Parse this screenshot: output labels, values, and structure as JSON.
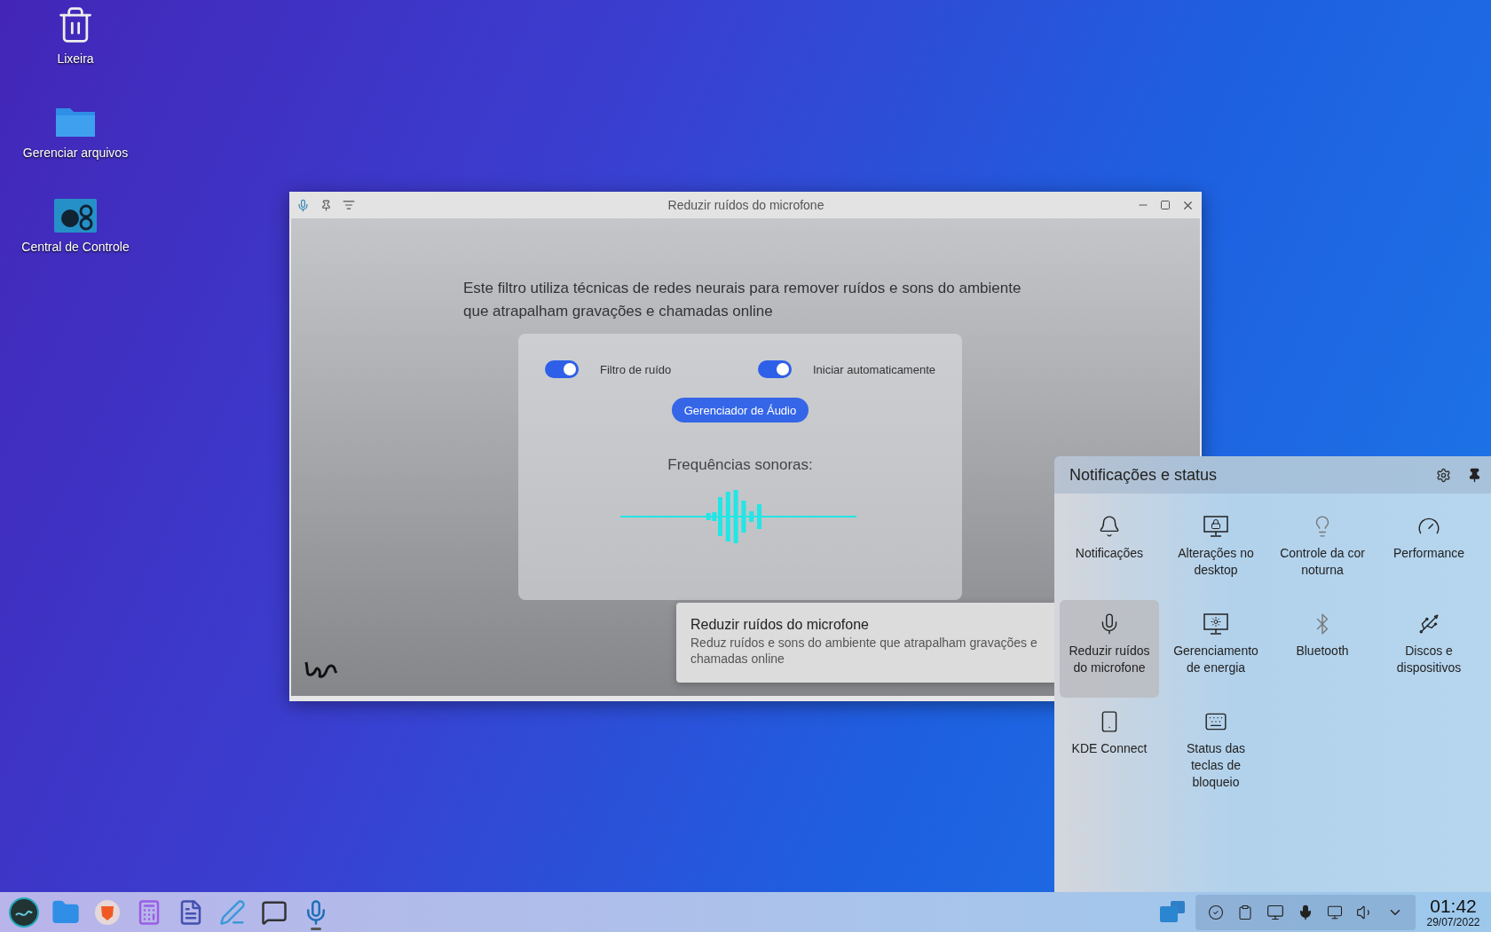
{
  "desktop_icons": [
    {
      "kind": "trash",
      "label": "Lixeira"
    },
    {
      "kind": "folder",
      "label": "Gerenciar arquivos"
    },
    {
      "kind": "control",
      "label": "Central de Controle"
    }
  ],
  "window": {
    "title": "Reduzir ruídos do microfone",
    "description": "Este filtro utiliza técnicas de redes neurais para remover ruídos e sons do ambiente que atrapalham gravações e chamadas online",
    "toggles": [
      {
        "label": "Filtro de ruído",
        "on": true
      },
      {
        "label": "Iniciar automaticamente",
        "on": true
      }
    ],
    "button": "Gerenciador de Áudio",
    "frequencies_label": "Frequências sonoras:"
  },
  "tooltip": {
    "title": "Reduzir ruídos do microfone",
    "text": "Reduz ruídos e sons do ambiente que atrapalham gravações e chamadas online"
  },
  "tray_popup": {
    "title": "Notificações e status",
    "items": [
      {
        "kind": "bell",
        "label": "Notificações",
        "selected": false
      },
      {
        "kind": "desktop-lock",
        "label": "Alterações no desktop",
        "selected": false
      },
      {
        "kind": "bulb",
        "label": "Controle da cor noturna",
        "selected": false
      },
      {
        "kind": "gauge",
        "label": "Performance",
        "selected": false
      },
      {
        "kind": "mic",
        "label": "Reduzir ruídos do microfone",
        "selected": true
      },
      {
        "kind": "energy",
        "label": "Gerenciamento de energia",
        "selected": false
      },
      {
        "kind": "bluetooth",
        "label": "Bluetooth",
        "selected": false
      },
      {
        "kind": "usb",
        "label": "Discos e dispositivos",
        "selected": false
      },
      {
        "kind": "phone",
        "label": "KDE Connect",
        "selected": false
      },
      {
        "kind": "keyboard",
        "label": "Status das teclas de bloqueio",
        "selected": false
      }
    ]
  },
  "taskbar": {
    "apps": [
      {
        "kind": "menu",
        "active": false
      },
      {
        "kind": "folder",
        "active": false
      },
      {
        "kind": "browser",
        "active": false
      },
      {
        "kind": "calc",
        "active": false
      },
      {
        "kind": "docs",
        "active": false
      },
      {
        "kind": "editor",
        "active": false
      },
      {
        "kind": "speech",
        "active": false
      },
      {
        "kind": "mic",
        "active": true
      }
    ],
    "clock": {
      "time": "01:42",
      "date": "29/07/2022"
    }
  }
}
